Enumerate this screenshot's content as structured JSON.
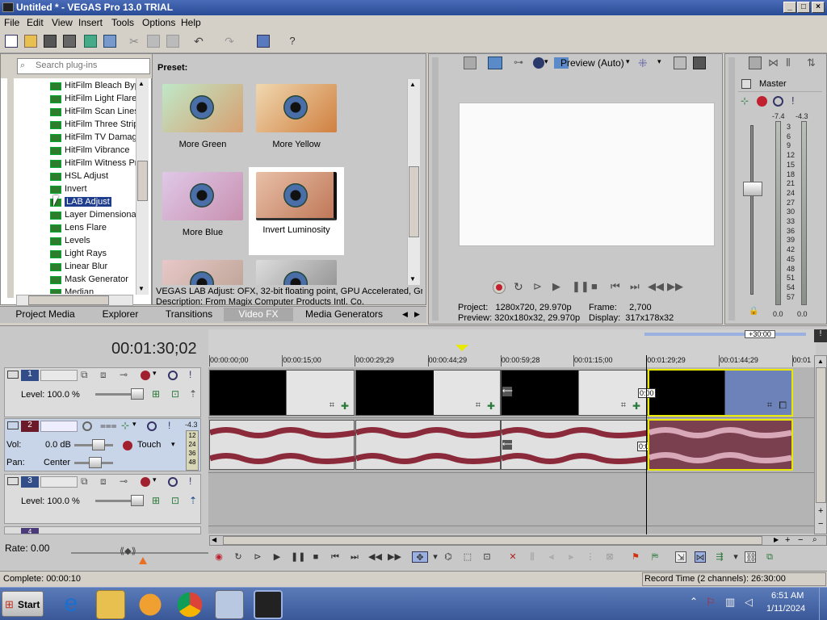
{
  "window": {
    "title": "Untitled * - VEGAS Pro 13.0 TRIAL"
  },
  "menu": [
    "File",
    "Edit",
    "View",
    "Insert",
    "Tools",
    "Options",
    "Help"
  ],
  "plugins": {
    "search_placeholder": "Search plug-ins",
    "items": [
      "HitFilm Bleach Byp",
      "HitFilm Light Flares",
      "HitFilm Scan Lines",
      "HitFilm Three Strip",
      "HitFilm TV Damage",
      "HitFilm Vibrance",
      "HitFilm Witness Pr",
      "HSL Adjust",
      "Invert",
      "LAB Adjust",
      "Layer Dimensional",
      "Lens Flare",
      "Levels",
      "Light Rays",
      "Linear Blur",
      "Mask Generator",
      "Median"
    ],
    "selected_index": 9
  },
  "preset": {
    "label": "Preset:",
    "items": [
      "More Green",
      "More Yellow",
      "More Blue",
      "Invert Luminosity"
    ],
    "selected": "Invert Luminosity",
    "description_line1": "VEGAS LAB Adjust: OFX, 32-bit floating point, GPU Accelerated, Gro",
    "description_line2": "Description: From Magix Computer Products Intl. Co."
  },
  "tabs": [
    "Project Media",
    "Explorer",
    "Transitions",
    "Video FX",
    "Media Generators"
  ],
  "active_tab": "Video FX",
  "preview": {
    "mode": "Preview (Auto)",
    "project_label": "Project:",
    "project_value": "1280x720, 29.970p",
    "preview_label": "Preview:",
    "preview_value": "320x180x32, 29.970p",
    "frame_label": "Frame:",
    "frame_value": "2,700",
    "display_label": "Display:",
    "display_value": "317x178x32"
  },
  "master": {
    "label": "Master",
    "peak_left": "-7.4",
    "peak_right": "-4.3",
    "scale": [
      "3",
      "6",
      "9",
      "12",
      "15",
      "18",
      "21",
      "24",
      "27",
      "30",
      "33",
      "36",
      "39",
      "42",
      "45",
      "48",
      "51",
      "54",
      "57"
    ],
    "fader_left": "0.0",
    "fader_right": "0.0"
  },
  "timeline": {
    "timecode": "00:01:30;02",
    "marker": "+30:00",
    "ruler": [
      "00:00:00;00",
      "00:00:15;00",
      "00:00:29;29",
      "00:00:44;29",
      "00:00:59;28",
      "00:01:15;00",
      "00:01:29;29",
      "00:01:44;29",
      "00:01"
    ],
    "clip_label": "0:00",
    "tracks": [
      {
        "number": "1",
        "level_label": "Level:",
        "level_value": "100.0 %"
      },
      {
        "number": "2",
        "vol_label": "Vol:",
        "vol_value": "0.0 dB",
        "pan_label": "Pan:",
        "pan_value": "Center",
        "mode": "Touch",
        "meter_top": "-4.3",
        "meter_values": [
          "12",
          "24",
          "36",
          "48"
        ]
      },
      {
        "number": "3",
        "level_label": "Level:",
        "level_value": "100.0 %"
      },
      {
        "number": "4"
      }
    ],
    "rate_label": "Rate: 0.00"
  },
  "status": {
    "complete": "Complete: 00:00:10",
    "record_time": "Record Time (2 channels): 26:30:00"
  },
  "taskbar": {
    "start": "Start",
    "time": "6:51 AM",
    "date": "1/11/2024"
  },
  "colors": {
    "selection": "#1e3d8c",
    "audio_wave": "#8a2a3a",
    "audio_selected": "#7a4050",
    "video_selected": "#6d82b8",
    "highlight_border": "#e8e800"
  }
}
